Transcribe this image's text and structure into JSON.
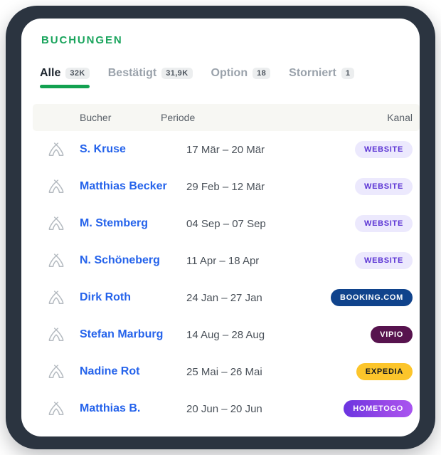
{
  "card": {
    "title": "BUCHUNGEN"
  },
  "tabs": [
    {
      "label": "Alle",
      "count": "32K",
      "active": true,
      "name": "tab-alle"
    },
    {
      "label": "Bestätigt",
      "count": "31,9K",
      "active": false,
      "name": "tab-bestaetigt"
    },
    {
      "label": "Option",
      "count": "18",
      "active": false,
      "name": "tab-option"
    },
    {
      "label": "Storniert",
      "count": "1",
      "active": false,
      "name": "tab-storniert"
    }
  ],
  "table": {
    "columns": {
      "guest": "Bucher",
      "period": "Periode",
      "channel": "Kanal"
    },
    "rows": [
      {
        "icon": "tent-icon",
        "guest": "S. Kruse",
        "period": "17 Mär – 20 Mär",
        "channel": "WEBSITE",
        "channel_style": "badge-website"
      },
      {
        "icon": "tent-icon",
        "guest": "Matthias Becker",
        "period": "29 Feb – 12 Mär",
        "channel": "WEBSITE",
        "channel_style": "badge-website"
      },
      {
        "icon": "tent-icon",
        "guest": "M. Stemberg",
        "period": "04 Sep – 07 Sep",
        "channel": "WEBSITE",
        "channel_style": "badge-website"
      },
      {
        "icon": "tent-icon",
        "guest": "N. Schöneberg",
        "period": "11 Apr – 18 Apr",
        "channel": "WEBSITE",
        "channel_style": "badge-website"
      },
      {
        "icon": "tent-icon",
        "guest": "Dirk Roth",
        "period": "24 Jan – 27 Jan",
        "channel": "BOOKING.COM",
        "channel_style": "badge-booking"
      },
      {
        "icon": "tent-icon",
        "guest": "Stefan Marburg",
        "period": "14 Aug – 28 Aug",
        "channel": "VIPIO",
        "channel_style": "badge-vipio"
      },
      {
        "icon": "tent-icon",
        "guest": "Nadine Rot",
        "period": "25 Mai – 26 Mai",
        "channel": "EXPEDIA",
        "channel_style": "badge-expedia"
      },
      {
        "icon": "tent-icon",
        "guest": "Matthias B.",
        "period": "20 Jun – 20 Jun",
        "channel": "HOMETOGO",
        "channel_style": "badge-hometogo"
      }
    ]
  },
  "colors": {
    "title_green": "#19a45c",
    "tab_underline": "#12a150",
    "guest_link": "#2563eb",
    "header_bg": "#f7f7f3",
    "device_bezel": "#2b3440",
    "badge_website_bg": "#ece9fd",
    "badge_website_fg": "#5b34d4",
    "badge_booking_bg": "#10438c",
    "badge_vipio_bg": "#57134e",
    "badge_expedia_bg": "#fcc52b",
    "badge_hometogo_from": "#6b34e0",
    "badge_hometogo_to": "#a855f0"
  }
}
